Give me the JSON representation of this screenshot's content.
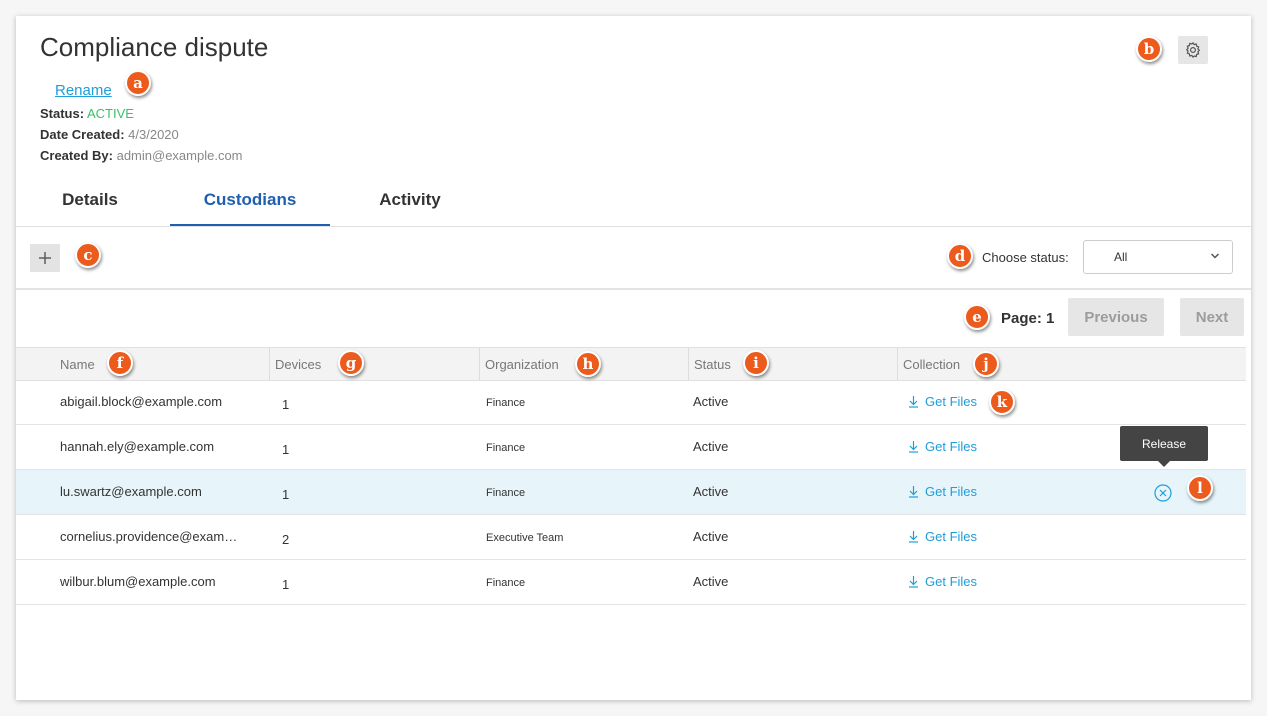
{
  "header": {
    "title": "Compliance dispute",
    "rename": "Rename",
    "status_label": "Status:",
    "status_value": "ACTIVE",
    "date_label": "Date Created:",
    "date_value": "4/3/2020",
    "created_label": "Created By:",
    "created_value": "admin@example.com"
  },
  "tabs": [
    "Details",
    "Custodians",
    "Activity"
  ],
  "active_tab": "Custodians",
  "toolbar": {
    "choose_status_label": "Choose status:",
    "status_selected": "All"
  },
  "pager": {
    "label": "Page: 1",
    "previous": "Previous",
    "next": "Next"
  },
  "table": {
    "columns": [
      "Name",
      "Devices",
      "Organization",
      "Status",
      "Collection"
    ],
    "rows": [
      {
        "name": "abigail.block@example.com",
        "devices": "1",
        "organization": "Finance",
        "status": "Active",
        "collection": "Get Files"
      },
      {
        "name": "hannah.ely@example.com",
        "devices": "1",
        "organization": "Finance",
        "status": "Active",
        "collection": "Get Files"
      },
      {
        "name": "lu.swartz@example.com",
        "devices": "1",
        "organization": "Finance",
        "status": "Active",
        "collection": "Get Files"
      },
      {
        "name": "cornelius.providence@exam…",
        "devices": "2",
        "organization": "Executive Team",
        "status": "Active",
        "collection": "Get Files"
      },
      {
        "name": "wilbur.blum@example.com",
        "devices": "1",
        "organization": "Finance",
        "status": "Active",
        "collection": "Get Files"
      }
    ],
    "highlighted_row": 2
  },
  "tooltip": "Release",
  "callouts": [
    "a",
    "b",
    "c",
    "d",
    "e",
    "f",
    "g",
    "h",
    "i",
    "j",
    "k",
    "l"
  ],
  "colors": {
    "accent": "#1f5fb0",
    "link": "#1e9ed9",
    "active_status": "#3bbf6a",
    "callout": "#ec5a1c",
    "row_highlight": "#e7f5fb"
  },
  "icons": {
    "settings": "gear-icon",
    "add": "plus-icon",
    "dropdown": "chevron-down-icon",
    "download": "download-icon",
    "release": "circle-x-icon"
  }
}
